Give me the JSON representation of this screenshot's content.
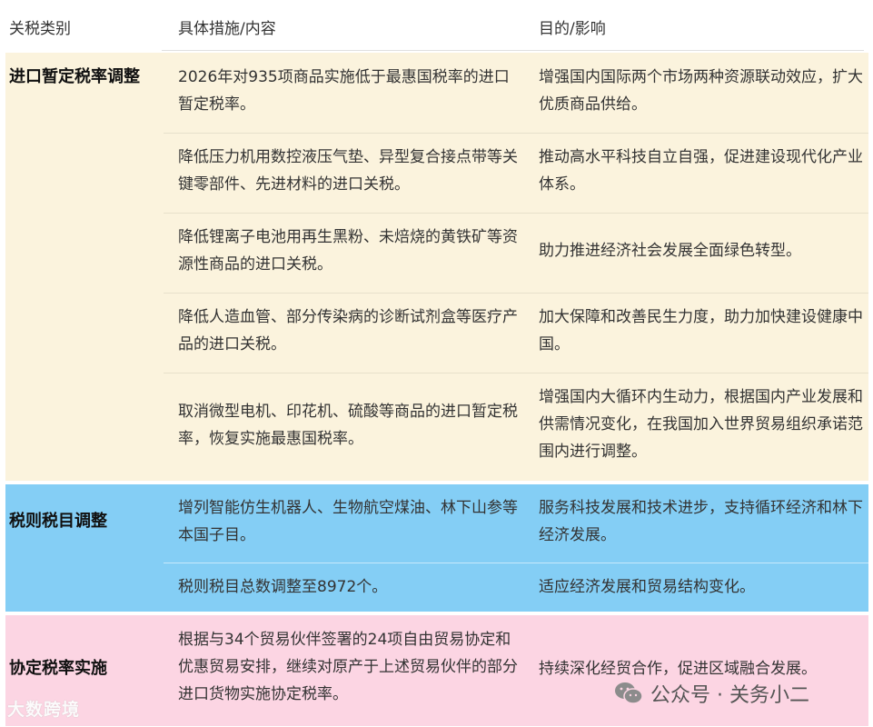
{
  "header": {
    "col1": "关税类别",
    "col2": "具体措施/内容",
    "col3": "目的/影响"
  },
  "groups": [
    {
      "category": "进口暂定税率调整",
      "rows": [
        {
          "measure": "2026年对935项商品实施低于最惠国税率的进口暂定税率。",
          "purpose": "增强国内国际两个市场两种资源联动效应，扩大优质商品供给。"
        },
        {
          "measure": "降低压力机用数控液压气垫、异型复合接点带等关键零部件、先进材料的进口关税。",
          "purpose": "推动高水平科技自立自强，促进建设现代化产业体系。"
        },
        {
          "measure": "降低锂离子电池用再生黑粉、未焙烧的黄铁矿等资源性商品的进口关税。",
          "purpose": "助力推进经济社会发展全面绿色转型。"
        },
        {
          "measure": "降低人造血管、部分传染病的诊断试剂盒等医疗产品的进口关税。",
          "purpose": "加大保障和改善民生力度，助力加快建设健康中国。"
        },
        {
          "measure": "取消微型电机、印花机、硫酸等商品的进口暂定税率，恢复实施最惠国税率。",
          "purpose": "增强国内大循环内生动力，根据国内产业发展和供需情况变化，在我国加入世界贸易组织承诺范围内进行调整。"
        }
      ]
    },
    {
      "category": "税则税目调整",
      "rows": [
        {
          "measure": "增列智能仿生机器人、生物航空煤油、林下山参等本国子目。",
          "purpose": "服务科技发展和技术进步，支持循环经济和林下经济发展。"
        },
        {
          "measure": "税则税目总数调整至8972个。",
          "purpose": "适应经济发展和贸易结构变化。"
        }
      ]
    },
    {
      "category": "协定税率实施",
      "rows": [
        {
          "measure": "根据与34个贸易伙伴签署的24项自由贸易协定和优惠贸易安排，继续对原产于上述贸易伙伴的部分进口货物实施协定税率。",
          "purpose": "持续深化经贸合作，促进区域融合发展。"
        }
      ]
    }
  ],
  "watermarks": {
    "left": "大数跨境",
    "right": "公众号 · 关务小二"
  }
}
